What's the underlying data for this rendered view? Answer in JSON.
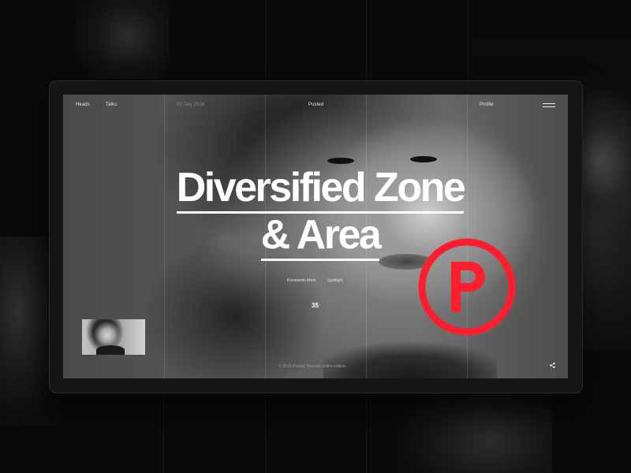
{
  "nav": {
    "heads": "Heads",
    "talks": "Talks",
    "date": "01 July 2018",
    "brand": "Posted",
    "profile": "Profile"
  },
  "hero": {
    "title_line_1": "Diversified Zone",
    "title_line_2": "& Area",
    "author": "Konstantin Mark",
    "category": "Spotlight",
    "page_number": "35"
  },
  "footer": {
    "copyright": "© 2018 Posted. Periodic online edition."
  },
  "icons": {
    "menu": "hamburger-menu-icon",
    "share": "share-icon",
    "badge": "posted-p-logo"
  },
  "colors": {
    "accent": "#ff1e2d",
    "text": "#ffffff",
    "background": "#0a0a0a"
  }
}
